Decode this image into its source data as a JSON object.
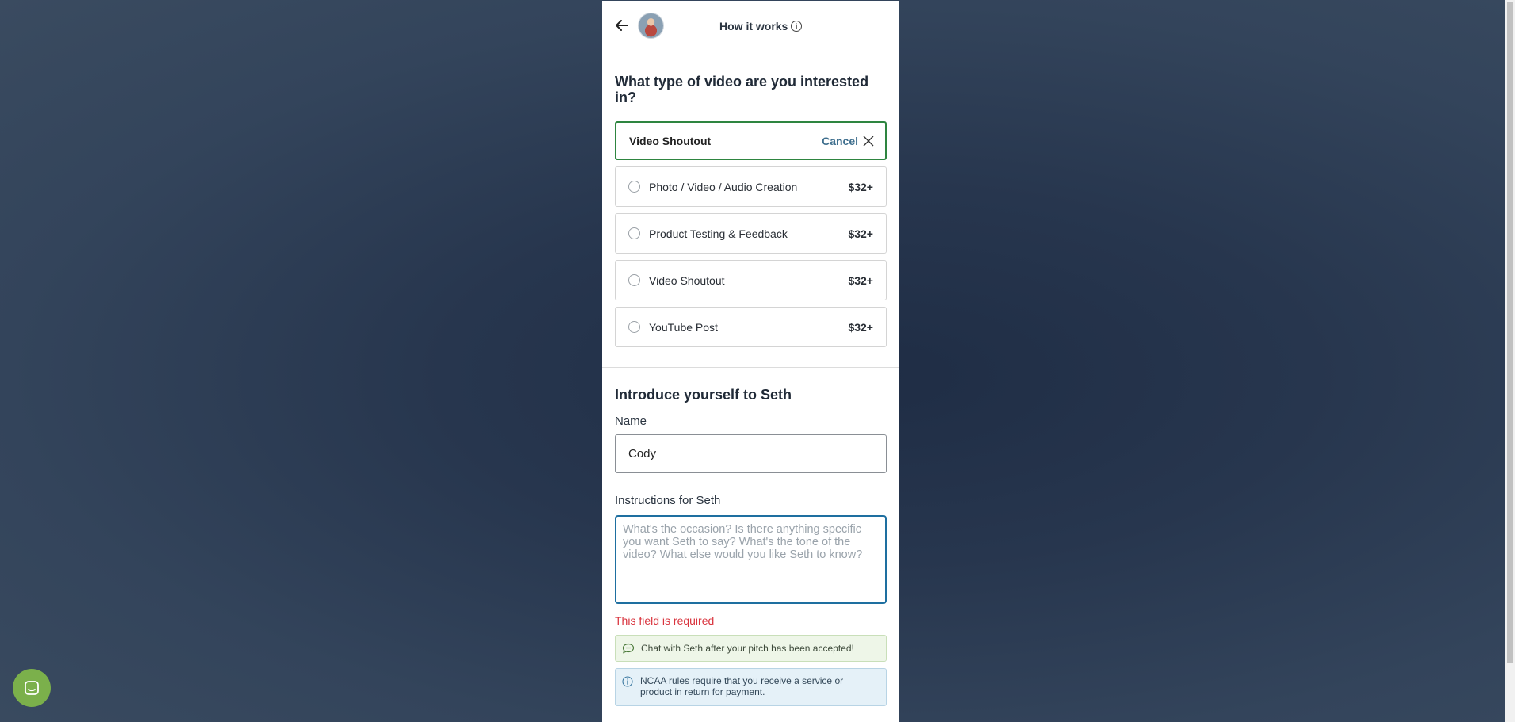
{
  "header": {
    "back_icon": "arrow-left-icon",
    "how_it_works_label": "How it works",
    "info_icon": "info-icon",
    "info_glyph": "i"
  },
  "video_type": {
    "question": "What type of video are you interested in?",
    "selected": "Video Shoutout",
    "cancel_label": "Cancel",
    "options": [
      {
        "label": "Photo / Video / Audio Creation",
        "price": "$32+"
      },
      {
        "label": "Product Testing & Feedback",
        "price": "$32+"
      },
      {
        "label": "Video Shoutout",
        "price": "$32+"
      },
      {
        "label": "YouTube Post",
        "price": "$32+"
      }
    ]
  },
  "intro": {
    "title": "Introduce yourself to Seth",
    "name_label": "Name",
    "name_value": "Cody",
    "instructions_label": "Instructions for Seth",
    "instructions_placeholder": "What's the occasion? Is there anything specific you want Seth to say? What's the tone of the video? What else would you like Seth to know?",
    "error_text": "This field is required",
    "chat_note": "Chat with Seth after your pitch has been accepted!",
    "ncaa_note": "NCAA rules require that you receive a service or product in return for payment."
  },
  "colors": {
    "accent_green": "#2e8540",
    "link_blue": "#3f6f8e",
    "focus_blue": "#1e6fa0",
    "error_red": "#d9343e",
    "launcher_green": "#7bb04b"
  }
}
